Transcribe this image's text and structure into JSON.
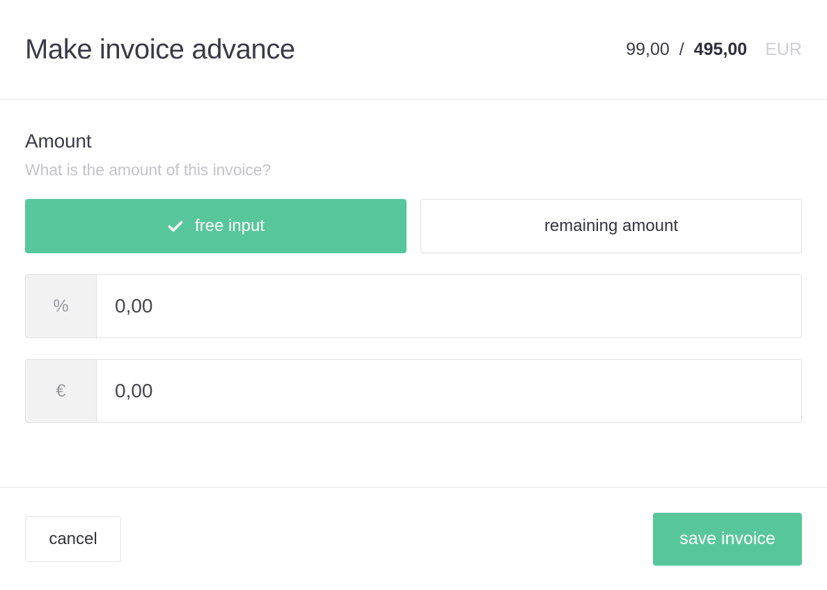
{
  "header": {
    "title": "Make invoice advance",
    "amount_paid": "99,00",
    "separator": "/",
    "amount_total": "495,00",
    "currency": "EUR"
  },
  "amount_section": {
    "heading": "Amount",
    "question": "What is the amount of this invoice?",
    "mode_options": [
      {
        "label": "free input",
        "selected": true,
        "icon": "check-icon"
      },
      {
        "label": "remaining amount",
        "selected": false
      }
    ],
    "fields": [
      {
        "addon": "%",
        "value": "0,00",
        "placeholder": "0,00",
        "name": "percent"
      },
      {
        "addon": "€",
        "value": "0,00",
        "placeholder": "0,00",
        "name": "euro"
      }
    ]
  },
  "footer": {
    "cancel_label": "cancel",
    "save_label": "save invoice"
  },
  "colors": {
    "accent_green": "#57c79b",
    "title_text": "#3a3a47",
    "muted_text": "#c3c3c9",
    "border": "#e2e2e4",
    "addon_bg": "#f2f2f2"
  }
}
